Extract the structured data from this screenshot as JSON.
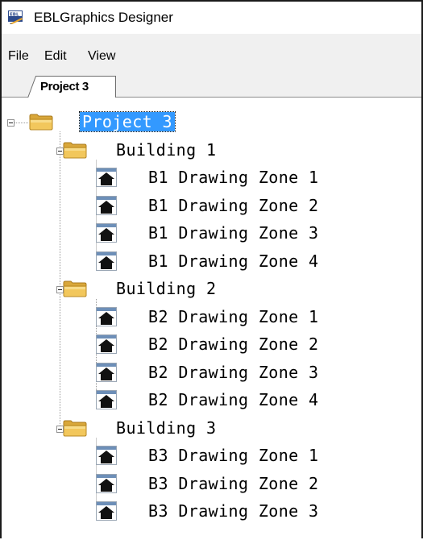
{
  "window": {
    "title": "EBLGraphics Designer"
  },
  "menu": {
    "items": [
      "File",
      "Edit",
      "View"
    ]
  },
  "tabs": [
    {
      "label": "Project 3",
      "active": true
    }
  ],
  "tree": {
    "root": {
      "label": "Project 3",
      "icon": "folder-icon",
      "selected": true,
      "expanded": true,
      "children": [
        {
          "label": "Building 1",
          "icon": "folder-icon",
          "expanded": true,
          "children": [
            {
              "label": "B1 Drawing Zone 1",
              "icon": "house-icon"
            },
            {
              "label": "B1 Drawing Zone 2",
              "icon": "house-icon"
            },
            {
              "label": "B1 Drawing Zone 3",
              "icon": "house-icon"
            },
            {
              "label": "B1 Drawing Zone 4",
              "icon": "house-icon"
            }
          ]
        },
        {
          "label": "Building 2",
          "icon": "folder-icon",
          "expanded": true,
          "children": [
            {
              "label": "B2 Drawing Zone 1",
              "icon": "house-icon"
            },
            {
              "label": "B2 Drawing Zone 2",
              "icon": "house-icon"
            },
            {
              "label": "B2 Drawing Zone 3",
              "icon": "house-icon"
            },
            {
              "label": "B2 Drawing Zone 4",
              "icon": "house-icon"
            }
          ]
        },
        {
          "label": "Building 3",
          "icon": "folder-icon",
          "expanded": true,
          "children": [
            {
              "label": "B3 Drawing Zone 1",
              "icon": "house-icon"
            },
            {
              "label": "B3 Drawing Zone 2",
              "icon": "house-icon"
            },
            {
              "label": "B3 Drawing Zone 3",
              "icon": "house-icon"
            }
          ]
        }
      ]
    }
  },
  "colors": {
    "selection": "#3399ff",
    "chrome": "#f0f0f0",
    "folder": "#e8b84a"
  }
}
